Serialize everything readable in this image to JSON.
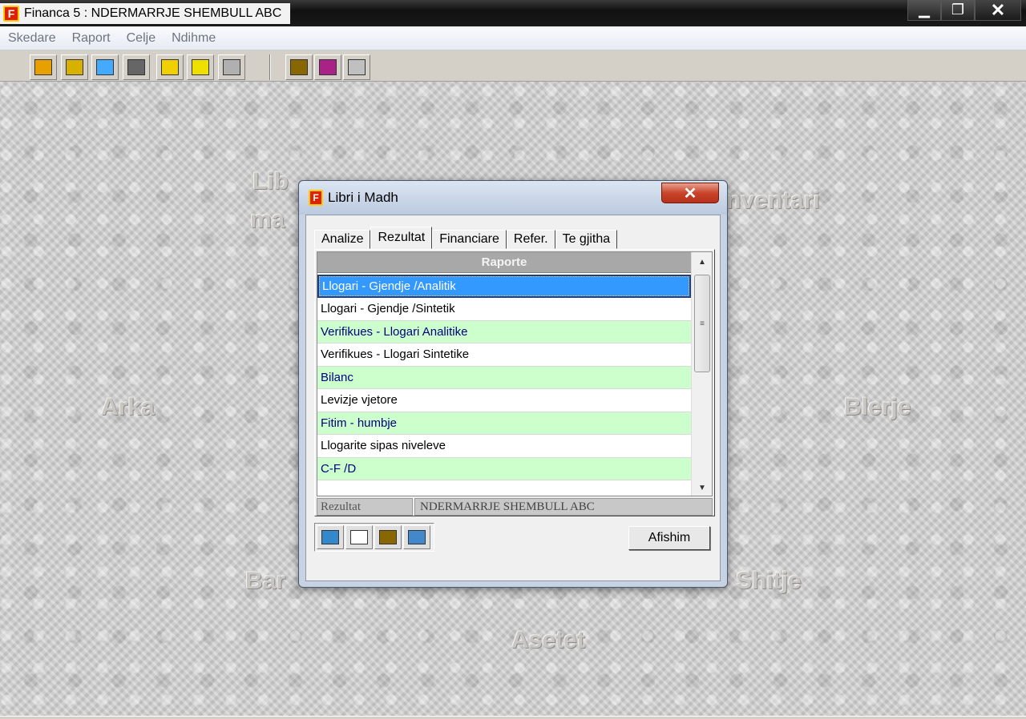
{
  "window": {
    "title": "Financa 5 :  NDERMARRJE SHEMBULL ABC",
    "app_icon_letter": "F",
    "minimize": "▁",
    "maximize": "❐",
    "close": "✕"
  },
  "menu": [
    "Skedare",
    "Raport",
    "Celje",
    "Ndihme"
  ],
  "toolbar": {
    "icons": [
      {
        "name": "books-icon",
        "color": "#e8a000"
      },
      {
        "name": "people-icon",
        "color": "#d8b000"
      },
      {
        "name": "person-icon",
        "color": "#44aaff"
      },
      {
        "name": "worker-icon",
        "color": "#666666"
      },
      {
        "name": "folder-open-icon",
        "color": "#f0d000"
      },
      {
        "name": "folder-edit-icon",
        "color": "#f0e000"
      },
      {
        "name": "disabled-doc-icon",
        "color": "#b0b0b0"
      },
      {
        "name": "calculator-doc-icon",
        "color": "#886600"
      },
      {
        "name": "book-icon",
        "color": "#aa2288"
      },
      {
        "name": "sparkle-icon",
        "color": "#c0c0c0"
      }
    ]
  },
  "desktop_modules": [
    {
      "label": "Lib",
      "id": "libri"
    },
    {
      "label": "ma",
      "id": "libri2"
    },
    {
      "label": "nventari",
      "id": "inventari"
    },
    {
      "label": "Arka",
      "id": "arka"
    },
    {
      "label": "Blerje",
      "id": "blerje"
    },
    {
      "label": "Bar",
      "id": "banka"
    },
    {
      "label": "Shitje",
      "id": "shitje"
    },
    {
      "label": "Asetet",
      "id": "asetet"
    }
  ],
  "dialog": {
    "title": "Libri i Madh",
    "close": "✕",
    "tabs": [
      "Analize",
      "Rezultat",
      "Financiare",
      "Refer.",
      "Te gjitha"
    ],
    "active_tab": "Rezultat",
    "grid_header": "Raporte",
    "rows": [
      {
        "label": "Llogari - Gjendje /Analitik",
        "style": "selected"
      },
      {
        "label": "Llogari - Gjendje /Sintetik",
        "style": "white"
      },
      {
        "label": "Verifikues - Llogari Analitike",
        "style": "green"
      },
      {
        "label": "Verifikues - Llogari Sintetike",
        "style": "white"
      },
      {
        "label": "Bilanc",
        "style": "green"
      },
      {
        "label": "Levizje vjetore",
        "style": "white"
      },
      {
        "label": "Fitim - humbje",
        "style": "green"
      },
      {
        "label": "Llogarite sipas niveleve",
        "style": "white"
      },
      {
        "label": "C-F /D",
        "style": "green"
      },
      {
        "label": "",
        "style": "white"
      }
    ],
    "status_left": "Rezultat",
    "status_right": "NDERMARRJE SHEMBULL ABC",
    "scroll_up": "▲",
    "scroll_down": "▼",
    "scroll_grip": "≡",
    "bottom_icons": [
      {
        "name": "calculator-icon",
        "color": "#3388cc"
      },
      {
        "name": "grid-icon",
        "color": "#ffffff"
      },
      {
        "name": "calc-doc-icon",
        "color": "#886600"
      },
      {
        "name": "export-icon",
        "color": "#4488cc"
      }
    ],
    "afishim_label": "Afishim"
  }
}
